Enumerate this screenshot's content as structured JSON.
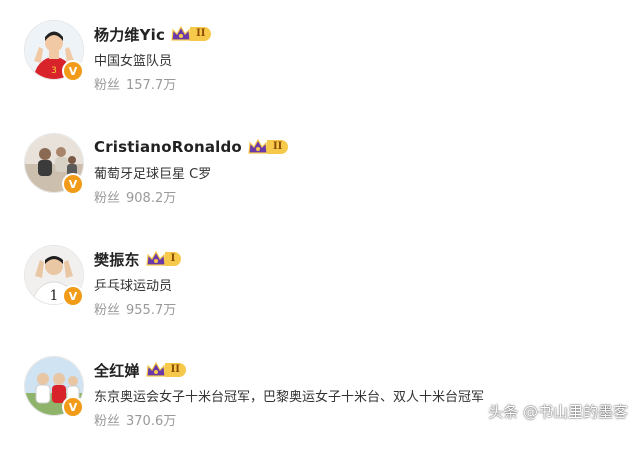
{
  "users": [
    {
      "name": "杨力维Yic",
      "level": "II",
      "description": "中国女篮队员",
      "fans_label": "粉丝",
      "fans_count": "157.7万"
    },
    {
      "name": "CristianoRonaldo",
      "level": "II",
      "description": "葡萄牙足球巨星 C罗",
      "fans_label": "粉丝",
      "fans_count": "908.2万"
    },
    {
      "name": "樊振东",
      "level": "I",
      "description": "乒乓球运动员",
      "fans_label": "粉丝",
      "fans_count": "955.7万"
    },
    {
      "name": "全红婵",
      "level": "II",
      "description": "东京奥运会女子十米台冠军，巴黎奥运女子十米台、双人十米台冠军",
      "fans_label": "粉丝",
      "fans_count": "370.6万"
    }
  ],
  "verify_mark": "V",
  "watermark": "头条 @书山里的墨客",
  "colors": {
    "verify": "#f29b18",
    "badge": "#f7c94b",
    "crown": "#6a3aa8"
  },
  "icons": {
    "verify": "verified-v-icon",
    "crown": "crown-icon"
  }
}
